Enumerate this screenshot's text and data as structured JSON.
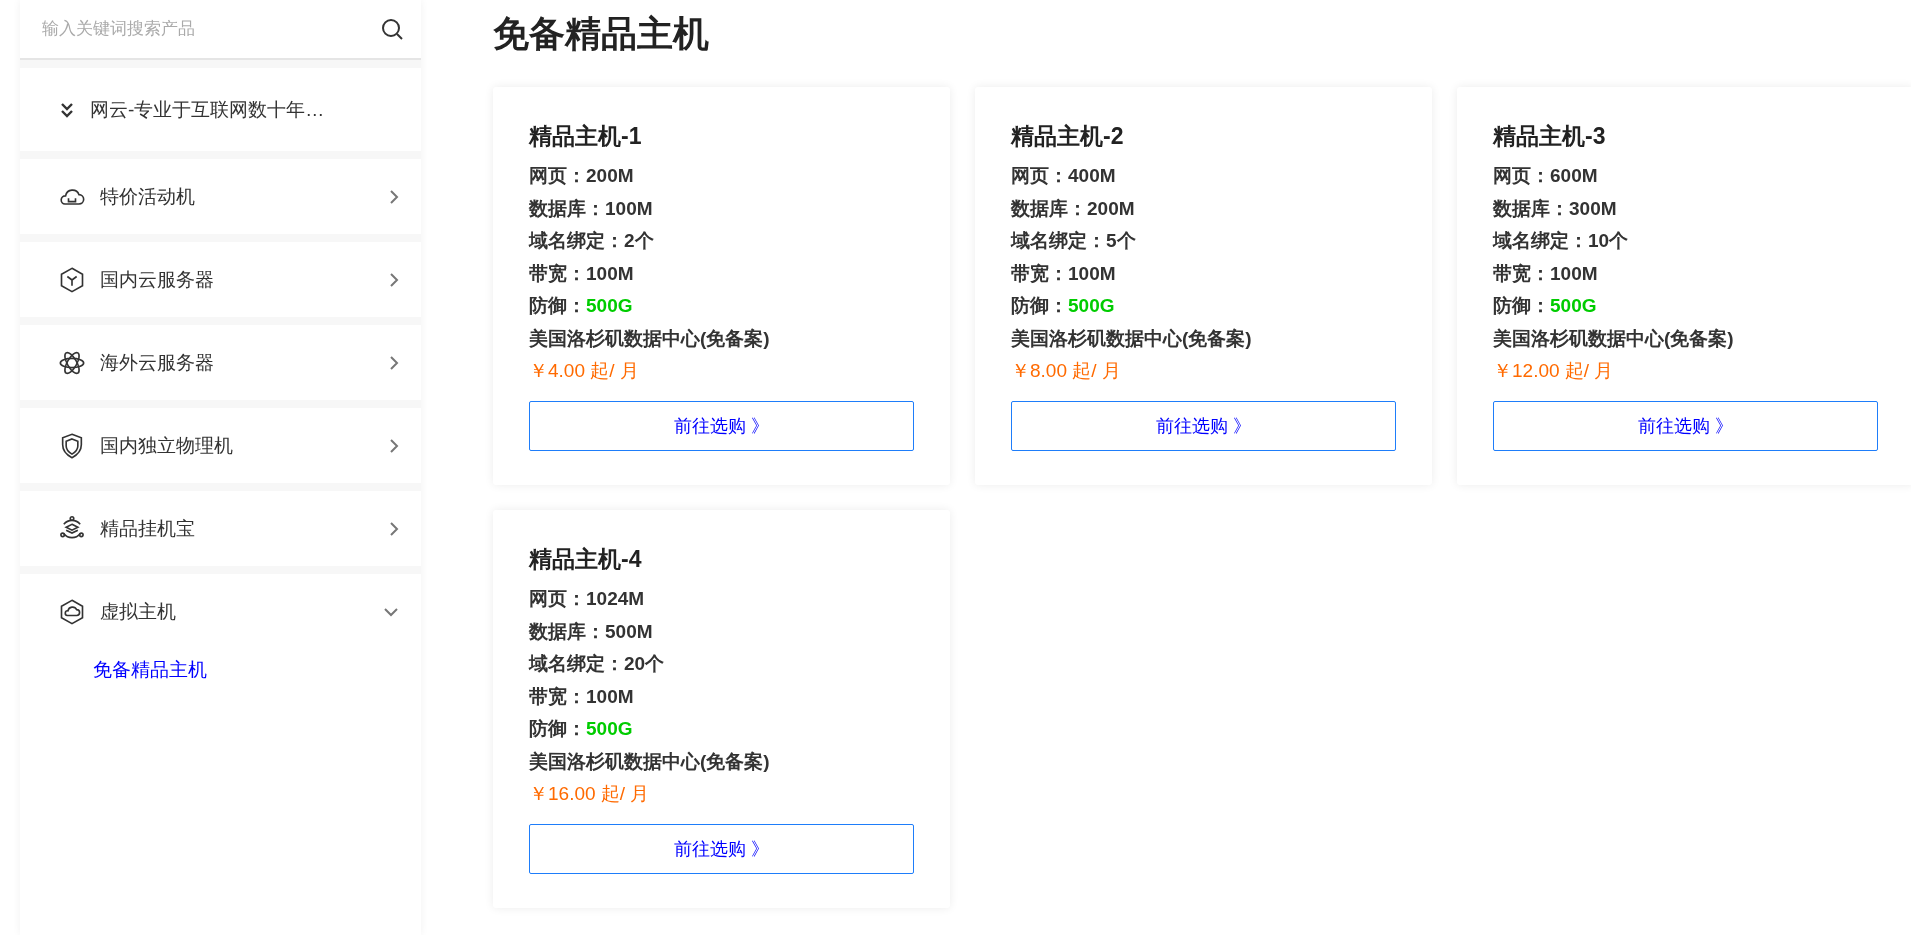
{
  "sidebar": {
    "search": {
      "placeholder": "输入关键词搜索产品"
    },
    "items": [
      {
        "kind": "header",
        "label": "网云-专业于互联网数十年…"
      },
      {
        "kind": "category",
        "label": "特价活动机",
        "expanded": false
      },
      {
        "kind": "category",
        "label": "国内云服务器",
        "expanded": false
      },
      {
        "kind": "category",
        "label": "海外云服务器",
        "expanded": false
      },
      {
        "kind": "category",
        "label": "国内独立物理机",
        "expanded": false
      },
      {
        "kind": "category",
        "label": "精品挂机宝",
        "expanded": false
      },
      {
        "kind": "category",
        "label": "虚拟主机",
        "expanded": true,
        "children": [
          {
            "label": "免备精品主机",
            "selected": true
          }
        ]
      }
    ]
  },
  "main": {
    "title": "免备精品主机",
    "cards": [
      {
        "title": "精品主机-1",
        "specs": [
          {
            "label": "网页：",
            "value": "200M",
            "highlight": false
          },
          {
            "label": "数据库：",
            "value": "100M",
            "highlight": false
          },
          {
            "label": "域名绑定：",
            "value": "2个",
            "highlight": false
          },
          {
            "label": "带宽：",
            "value": "100M",
            "highlight": false
          },
          {
            "label": "防御：",
            "value": "500G",
            "highlight": true
          }
        ],
        "location": "美国洛杉矶数据中心(免备案)",
        "price": "￥4.00 起/ 月",
        "button": "前往选购 》"
      },
      {
        "title": "精品主机-2",
        "specs": [
          {
            "label": "网页：",
            "value": "400M",
            "highlight": false
          },
          {
            "label": "数据库：",
            "value": "200M",
            "highlight": false
          },
          {
            "label": "域名绑定：",
            "value": "5个",
            "highlight": false
          },
          {
            "label": "带宽：",
            "value": "100M",
            "highlight": false
          },
          {
            "label": "防御：",
            "value": "500G",
            "highlight": true
          }
        ],
        "location": "美国洛杉矶数据中心(免备案)",
        "price": "￥8.00 起/ 月",
        "button": "前往选购 》"
      },
      {
        "title": "精品主机-3",
        "specs": [
          {
            "label": "网页：",
            "value": "600M",
            "highlight": false
          },
          {
            "label": "数据库：",
            "value": "300M",
            "highlight": false
          },
          {
            "label": "域名绑定：",
            "value": "10个",
            "highlight": false
          },
          {
            "label": "带宽：",
            "value": "100M",
            "highlight": false
          },
          {
            "label": "防御：",
            "value": "500G",
            "highlight": true
          }
        ],
        "location": "美国洛杉矶数据中心(免备案)",
        "price": "￥12.00 起/ 月",
        "button": "前往选购 》"
      },
      {
        "title": "精品主机-4",
        "specs": [
          {
            "label": "网页：",
            "value": "1024M",
            "highlight": false
          },
          {
            "label": "数据库：",
            "value": "500M",
            "highlight": false
          },
          {
            "label": "域名绑定：",
            "value": "20个",
            "highlight": false
          },
          {
            "label": "带宽：",
            "value": "100M",
            "highlight": false
          },
          {
            "label": "防御：",
            "value": "500G",
            "highlight": true
          }
        ],
        "location": "美国洛杉矶数据中心(免备案)",
        "price": "￥16.00 起/ 月",
        "button": "前往选购 》"
      }
    ]
  }
}
